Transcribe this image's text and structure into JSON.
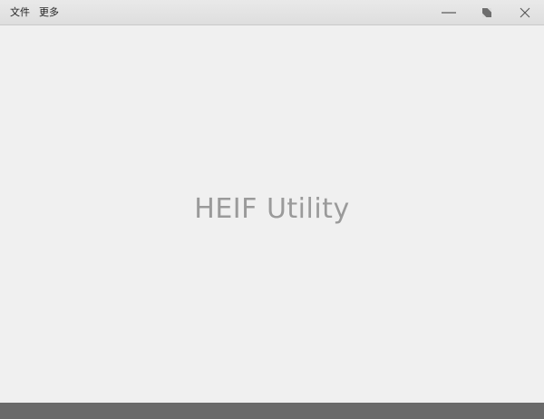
{
  "menu": {
    "file_label": "文件",
    "more_label": "更多"
  },
  "window_controls": {
    "minimize_icon": "minimize-icon",
    "restore_icon": "restore-icon",
    "close_icon": "close-icon"
  },
  "main": {
    "app_title": "HEIF Utility"
  },
  "colors": {
    "background": "#f0f0f0",
    "title_text": "#9a9a9a",
    "statusbar": "#6a6a6a"
  }
}
